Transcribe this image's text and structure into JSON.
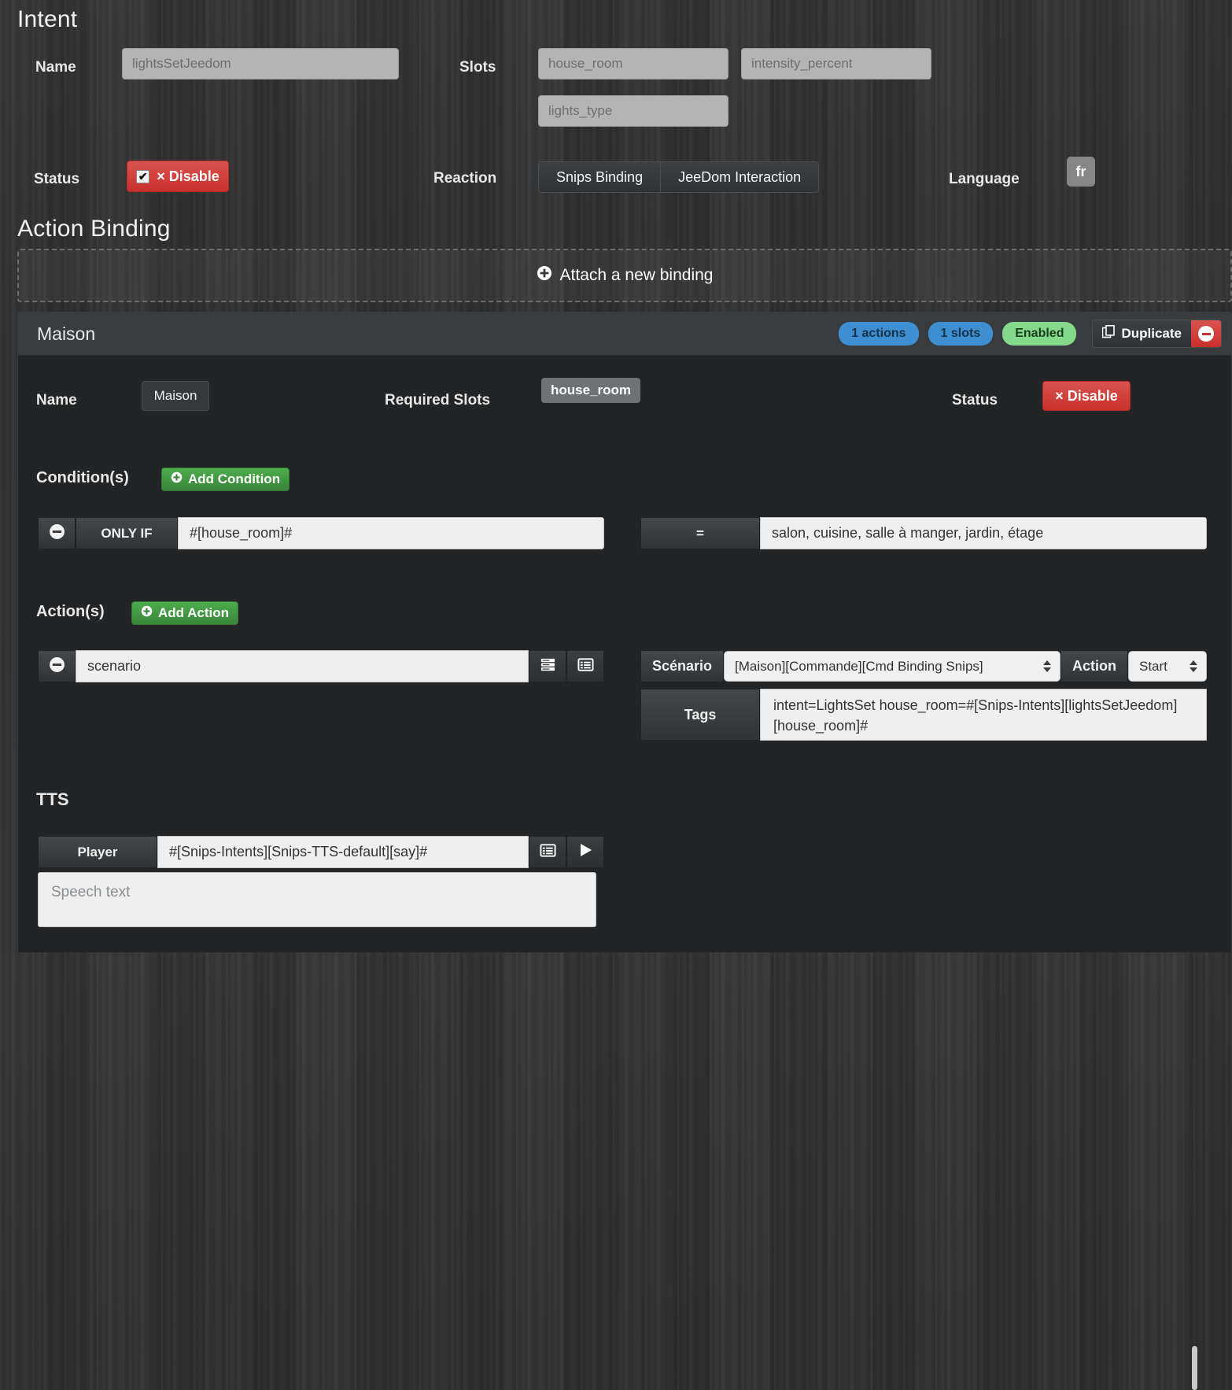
{
  "intent": {
    "title": "Intent",
    "name_label": "Name",
    "name_value": "lightsSetJeedom",
    "slots_label": "Slots",
    "slots": [
      "house_room",
      "intensity_percent",
      "lights_type"
    ],
    "status_label": "Status",
    "status_button": "× Disable",
    "status_checked": true,
    "reaction_label": "Reaction",
    "reaction_options": [
      "Snips Binding",
      "JeeDom Interaction"
    ],
    "language_label": "Language",
    "language_value": "fr"
  },
  "action_binding": {
    "title": "Action Binding",
    "attach_label": "Attach a new binding"
  },
  "binding": {
    "title": "Maison",
    "badges": {
      "actions": "1 actions",
      "slots": "1 slots",
      "state": "Enabled"
    },
    "duplicate_label": "Duplicate",
    "name_label": "Name",
    "name_value": "Maison",
    "required_slots_label": "Required Slots",
    "required_slot": "house_room",
    "status_label": "Status",
    "status_button": "× Disable",
    "conditions": {
      "label": "Condition(s)",
      "add_label": "Add Condition",
      "operator_label": "ONLY IF",
      "left_value": "#[house_room]#",
      "comparator": "=",
      "right_value": "salon, cuisine, salle à manger, jardin, étage"
    },
    "actions": {
      "label": "Action(s)",
      "add_label": "Add Action",
      "type_value": "scenario",
      "scenario_label": "Scénario",
      "scenario_value": "[Maison][Commande][Cmd Binding Snips]",
      "action_label": "Action",
      "action_value": "Start",
      "tags_label": "Tags",
      "tags_value": "intent=LightsSet house_room=#[Snips-Intents][lightsSetJeedom][house_room]#"
    },
    "tts": {
      "label": "TTS",
      "player_label": "Player",
      "player_value": "#[Snips-Intents][Snips-TTS-default][say]#",
      "speech_placeholder": "Speech text"
    }
  },
  "colors": {
    "danger": "#d9534f",
    "success": "#4cae4c",
    "info": "#3d8fd1",
    "enabled": "#84d98b",
    "panel_bg": "#222426",
    "panel_head": "#393c3f"
  }
}
